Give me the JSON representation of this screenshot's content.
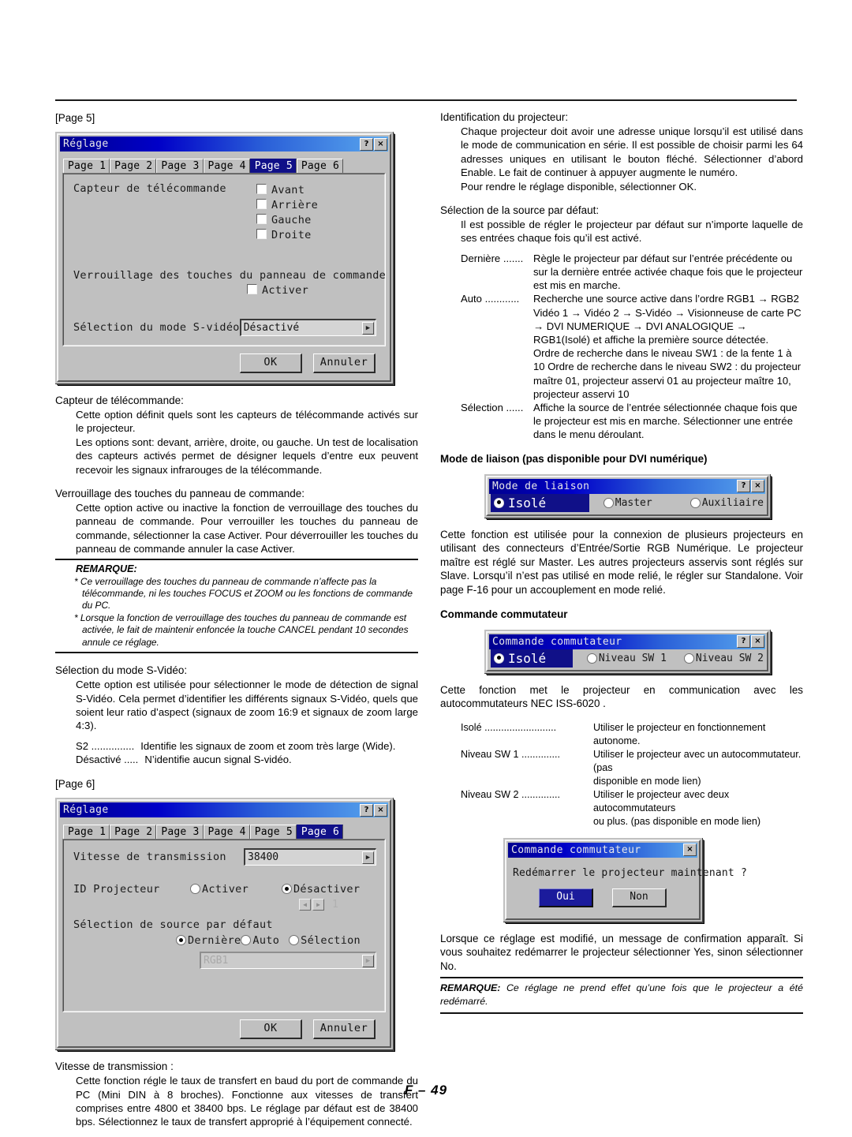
{
  "footer": {
    "page_label": "F – 49"
  },
  "left": {
    "page5_bracket": "[Page 5]",
    "dialog5": {
      "title": "Réglage",
      "help_btn": "?",
      "close_btn": "×",
      "tabs": [
        {
          "label": "Page 1",
          "selected": false
        },
        {
          "label": "Page 2",
          "selected": false
        },
        {
          "label": "Page 3",
          "selected": false
        },
        {
          "label": "Page 4",
          "selected": false
        },
        {
          "label": "Page 5",
          "selected": true
        },
        {
          "label": "Page 6",
          "selected": false
        }
      ],
      "sensor_label": "Capteur de télécommande",
      "sensor_options": [
        "Avant",
        "Arrière",
        "Gauche",
        "Droite"
      ],
      "keylock_label": "Verrouillage des touches du panneau de commande",
      "keylock_option": "Activer",
      "svideo_label": "Sélection du mode S-vidéo",
      "svideo_value": "Désactivé",
      "dropdown_arrow": "▶",
      "ok_label": "OK",
      "cancel_label": "Annuler"
    },
    "sec_sensor": {
      "term": "Capteur de télécommande:",
      "p1": "Cette option définit quels sont les capteurs de télécommande activés sur le projecteur.",
      "p2": "Les options sont: devant, arrière, droite, ou gauche. Un test de localisation des capteurs activés permet de désigner lequels d’entre eux peuvent recevoir les signaux infrarouges de la télécommande."
    },
    "sec_keylock": {
      "term": "Verrouillage des touches du panneau de commande:",
      "p1": "Cette option active ou inactive la fonction de verrouillage des touches du panneau de commande. Pour verrouiller les touches du panneau de commande, sélectionner la case Activer. Pour déverrouiller les touches du panneau de commande annuler la case Activer.",
      "note_title": "REMARQUE:",
      "note_items": [
        "* Ce verrouillage des touches du panneau de commande n’affecte pas la télécommande, ni les touches FOCUS et ZOOM ou les fonctions de commande du PC.",
        "* Lorsque la fonction de verrouillage des touches du panneau de commande est activée, le fait de maintenir enfoncée la touche CANCEL pendant 10 secondes annule ce réglage."
      ]
    },
    "sec_svideo": {
      "term": "Sélection du mode S-Vidéo:",
      "p1": "Cette option est utilisée pour sélectionner le mode de détection de signal S-Vidéo. Cela permet d’identifier les différents signaux S-Vidéo, quels que soient leur ratio d’aspect (signaux de zoom 16:9 et signaux de zoom large 4:3).",
      "defs": [
        {
          "term": "S2 ...............",
          "desc": "Identifie les signaux de zoom et zoom très large (Wide)."
        },
        {
          "term": "Désactivé .....",
          "desc": "N’identifie aucun signal S-vidéo."
        }
      ]
    },
    "page6_bracket": "[Page 6]",
    "dialog6": {
      "title": "Réglage",
      "help_btn": "?",
      "close_btn": "×",
      "tabs": [
        {
          "label": "Page 1",
          "selected": false
        },
        {
          "label": "Page 2",
          "selected": false
        },
        {
          "label": "Page 3",
          "selected": false
        },
        {
          "label": "Page 4",
          "selected": false
        },
        {
          "label": "Page 5",
          "selected": false
        },
        {
          "label": "Page 6",
          "selected": true
        }
      ],
      "baud_label": "Vitesse de transmission",
      "baud_value": "38400",
      "projid_label": "ID Projecteur",
      "projid_enable": "Activer",
      "projid_disable": "Désactiver",
      "spin_left": "◀",
      "spin_right": "▶",
      "spin_value": "1",
      "defsrc_label": "Sélection de source par défaut",
      "defsrc_opt1": "Dernière",
      "defsrc_opt2": "Auto",
      "defsrc_opt3": "Sélection",
      "source_value": "RGB1",
      "dropdown_arrow": "▶",
      "ok_label": "OK",
      "cancel_label": "Annuler"
    },
    "sec_baud": {
      "term": "Vitesse de transmission :",
      "p1": "Cette fonction régle le taux de transfert en baud du port de commande du PC (Mini DIN à 8 broches). Fonctionne aux vitesses de transfert comprises entre 4800 et 38400 bps. Le réglage par défaut est de 38400 bps. Sélectionnez le taux de transfert approprié à l’équipement connecté."
    }
  },
  "right": {
    "sec_projid": {
      "term": "Identification du projecteur:",
      "p1": "Chaque projecteur doit avoir une adresse unique lorsqu’il est utilisé dans le mode de communication en série. Il est possible de choisir parmi les 64 adresses uniques en utilisant le bouton fléché. Sélectionner d’abord Enable. Le fait de continuer à appuyer augmente le numéro.",
      "p2": "Pour rendre le réglage disponible, sélectionner OK."
    },
    "sec_defsrc": {
      "term": "Sélection de la source par défaut:",
      "p1": "Il est possible de régler le projecteur par défaut sur n’importe laquelle de ses entrées chaque fois qu’il est activé.",
      "defs": [
        {
          "term": "Dernière .......",
          "desc": "Règle le projecteur par défaut sur l’entrée précédente ou sur la dernière entrée activée chaque fois que le projecteur est mis en marche."
        },
        {
          "term": "Auto ............",
          "desc": "Recherche une source active dans l’ordre RGB1 → RGB2 Vidéo 1 → Vidéo 2 → S-Vidéo → Visionneuse de carte PC → DVI NUMERIQUE → DVI ANALOGIQUE → RGB1(Isolé) et affiche la première source détectée.",
          "extra": "Ordre de recherche dans le niveau SW1 : de la fente 1 à 10 Ordre de recherche dans le niveau SW2 : du projecteur maître 01, projecteur asservi 01 au projecteur maître 10, projecteur asservi 10"
        },
        {
          "term": "Sélection ......",
          "desc": "Affiche la source de l’entrée sélectionnée chaque fois que le projecteur est mis en marche. Sélectionner une entrée dans le menu déroulant."
        }
      ]
    },
    "sec_link": {
      "heading": "Mode de liaison (pas disponible pour DVI numérique)",
      "dialog": {
        "title": "Mode de liaison",
        "help_btn": "?",
        "close_btn": "×",
        "opt_selected": "Isolé",
        "opt2": "Master",
        "opt3": "Auxiliaire"
      },
      "p1": "Cette fonction est utilisée pour la connexion de plusieurs projecteurs en utilisant des connecteurs d’Entrée/Sortie RGB Numérique. Le projecteur maître est réglé sur Master. Les autres projecteurs asservis sont réglés sur Slave. Lorsqu’il n’est pas utilisé en mode relié, le régler sur Standalone. Voir page F-16 pour un accouplement en mode relié."
    },
    "sec_switcher": {
      "heading": "Commande commutateur",
      "dialog": {
        "title": "Commande commutateur",
        "help_btn": "?",
        "close_btn": "×",
        "opt_selected": "Isolé",
        "opt2": "Niveau SW 1",
        "opt3": "Niveau SW 2"
      },
      "p1": "Cette fonction met le projecteur en communication avec les autocommutateurs NEC ISS-6020 .",
      "defs": [
        {
          "term": "Isolé ..........................",
          "desc": "Utiliser le projecteur en fonctionnement autonome."
        },
        {
          "term": "Niveau SW 1 ..............",
          "desc": "Utiliser le projecteur avec un autocommutateur. (pas",
          "extra": "disponible en mode lien)"
        },
        {
          "term": "Niveau SW 2 ..............",
          "desc": "Utiliser le projecteur avec deux autocommutateurs",
          "extra": "ou plus. (pas disponible en mode lien)"
        }
      ],
      "confirm": {
        "title": "Commande commutateur",
        "close_btn": "×",
        "message": "Redémarrer le projecteur maintenant ?",
        "yes_label": "Oui",
        "no_label": "Non"
      },
      "p2": "Lorsque ce réglage est modifié, un message de confirmation apparaît. Si vous souhaitez redémarrer le projecteur sélectionner Yes, sinon sélectionner No.",
      "remark_label": "REMARQUE:",
      "remark_text": " Ce réglage ne prend effet qu’une fois que le projecteur a été redémarré."
    }
  }
}
